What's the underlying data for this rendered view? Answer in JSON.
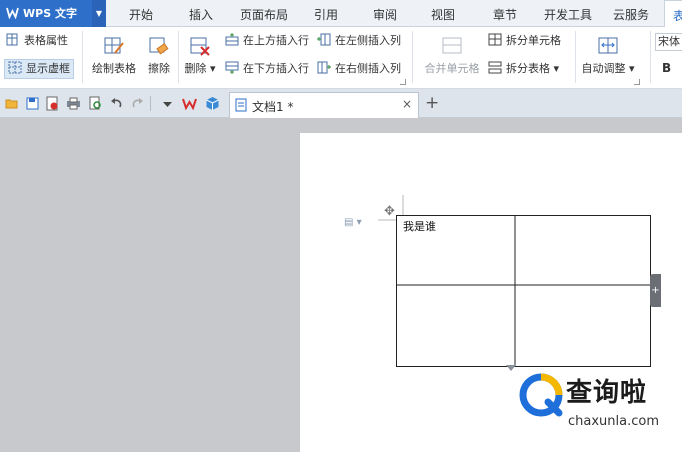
{
  "app": {
    "name": "WPS 文字"
  },
  "menu_tabs": [
    "开始",
    "插入",
    "页面布局",
    "引用",
    "审阅",
    "视图",
    "章节",
    "开发工具",
    "云服务",
    "表"
  ],
  "ribbon": {
    "table_properties": "表格属性",
    "show_gridlines": "显示虚框",
    "draw_table": "绘制表格",
    "eraser": "擦除",
    "delete": "删除",
    "insert_row_above": "在上方插入行",
    "insert_row_below": "在下方插入行",
    "insert_col_left": "在左侧插入列",
    "insert_col_right": "在右侧插入列",
    "merge_cells": "合并单元格",
    "split_cells": "拆分单元格",
    "split_table": "拆分表格",
    "auto_fit": "自动调整",
    "font_name": "宋体",
    "bold": "B"
  },
  "doc_tab": {
    "title": "文档1 *",
    "close": "×",
    "new": "+"
  },
  "document": {
    "cell_1_1": "我是谁"
  },
  "watermark": {
    "brand": "查询啦",
    "url": "chaxunla.com"
  },
  "colors": {
    "accent": "#2e6fc9",
    "wps_red": "#d62d2d"
  }
}
